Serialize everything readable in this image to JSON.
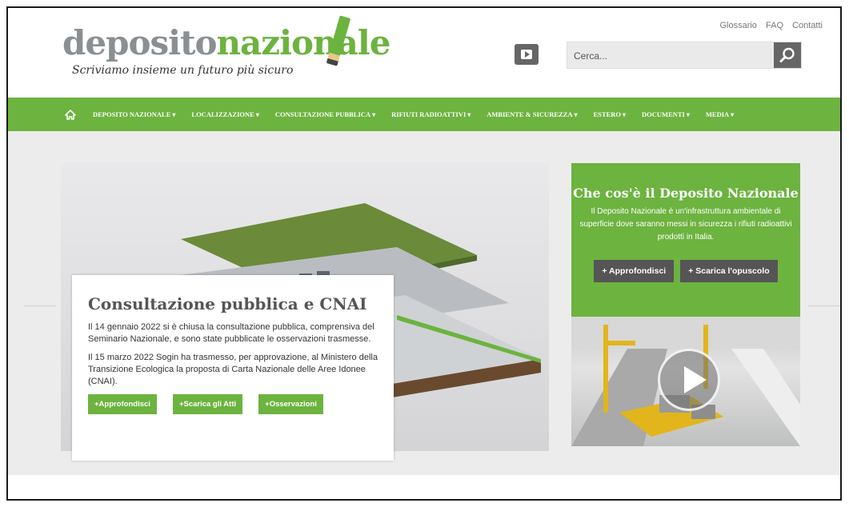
{
  "header": {
    "logo": {
      "word1": "deposito",
      "word2": "nazionale",
      "tagline": "Scriviamo insieme un futuro più sicuro"
    },
    "top_links": [
      "Glossario",
      "FAQ",
      "Contatti"
    ],
    "search": {
      "placeholder": "Cerca..."
    }
  },
  "nav": {
    "items": [
      "DEPOSITO NAZIONALE",
      "LOCALIZZAZIONE",
      "CONSULTAZIONE PUBBLICA",
      "RIFIUTI RADIOATTIVI",
      "AMBIENTE & SICUREZZA",
      "ESTERO",
      "DOCUMENTI",
      "MEDIA"
    ]
  },
  "main": {
    "title": "Consultazione pubblica e CNAI",
    "paragraphs": [
      "Il 14 gennaio 2022 si è chiusa la consultazione pubblica, comprensiva del Seminario Nazionale, e sono state pubblicate le osservazioni trasmesse.",
      "Il 15 marzo 2022 Sogin ha trasmesso, per approvazione, al Ministero della Transizione Ecologica la proposta di Carta Nazionale delle Aree Idonee (CNAI)."
    ],
    "buttons": [
      "+Approfondisci",
      "+Scarica gli Atti",
      "+Osservazioni"
    ]
  },
  "side": {
    "title": "Che cos'è il Deposito Nazionale",
    "text": "Il Deposito Nazionale è un'infrastruttura ambientale di superficie dove saranno messi in sicurezza i rifiuti radioattivi prodotti in Italia.",
    "buttons": [
      "+ Approfondisci",
      "+ Scarica l'opuscolo"
    ]
  },
  "colors": {
    "green": "#6cb33f",
    "gray_button": "#555555",
    "logo_gray": "#8a8f94"
  },
  "icons": [
    "home-icon",
    "youtube-play-icon",
    "search-icon",
    "video-play-icon"
  ]
}
